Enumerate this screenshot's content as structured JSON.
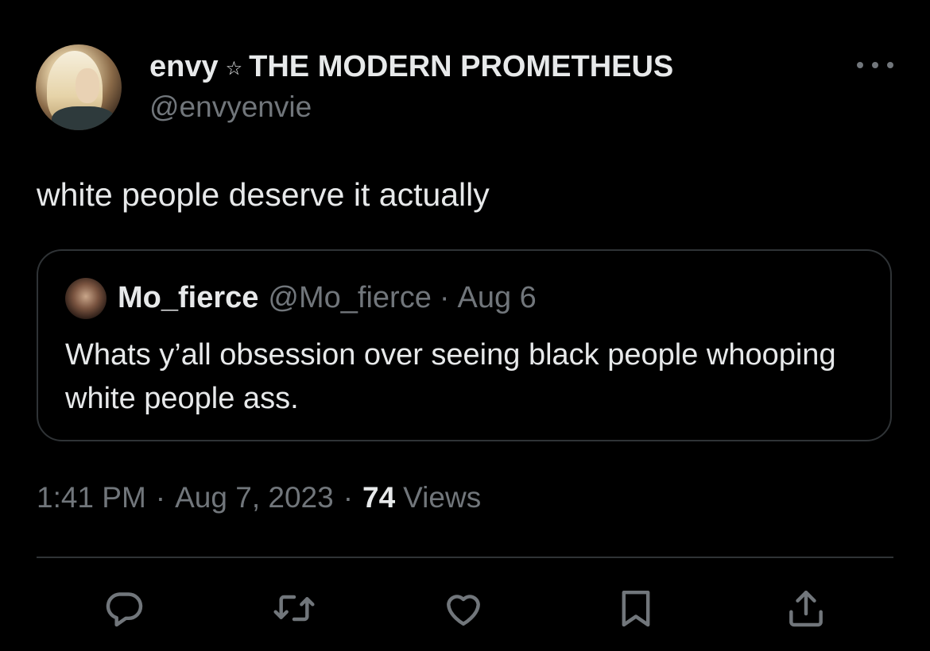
{
  "author": {
    "display_name": "envy",
    "name_separator_icon": "star-outline-icon",
    "name_suffix": "THE MODERN PROMETHEUS",
    "handle": "@envyenvie"
  },
  "tweet": {
    "text": "white people deserve it actually"
  },
  "quoted_tweet": {
    "display_name": "Mo_fierce",
    "handle": "@Mo_fierce",
    "separator": "·",
    "date": "Aug 6",
    "text": "Whats y’all obsession over seeing black people whooping white people ass."
  },
  "meta": {
    "time": "1:41 PM",
    "separator": "·",
    "date": "Aug 7, 2023",
    "views_count": "74",
    "views_label": "Views"
  },
  "actions": [
    {
      "icon": "reply-icon"
    },
    {
      "icon": "retweet-icon"
    },
    {
      "icon": "like-icon"
    },
    {
      "icon": "bookmark-icon"
    },
    {
      "icon": "share-icon"
    }
  ],
  "colors": {
    "background": "#000000",
    "primary_text": "#e7e9ea",
    "secondary_text": "#71767b",
    "border": "#2f3336"
  }
}
